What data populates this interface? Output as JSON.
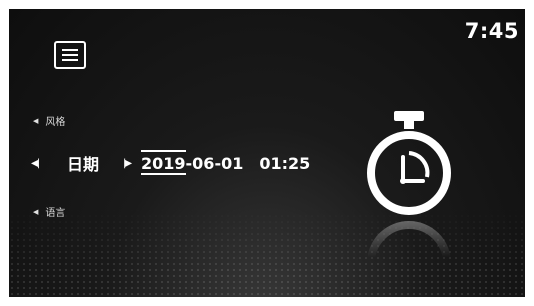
{
  "status": {
    "time": "7:45"
  },
  "menu": {
    "icon": "menu-icon"
  },
  "settings": {
    "items": [
      {
        "label": "风格"
      },
      {
        "label": "日期"
      },
      {
        "label": "语言"
      }
    ],
    "date_value": {
      "year": "2019",
      "month_day": "-06-01",
      "time": "01:25"
    }
  },
  "icons": {
    "stopwatch": "stopwatch-icon",
    "left_arrow": "triangle-left-icon",
    "right_arrow": "triangle-right-icon"
  },
  "colors": {
    "background": "#141414",
    "foreground": "#ffffff"
  }
}
